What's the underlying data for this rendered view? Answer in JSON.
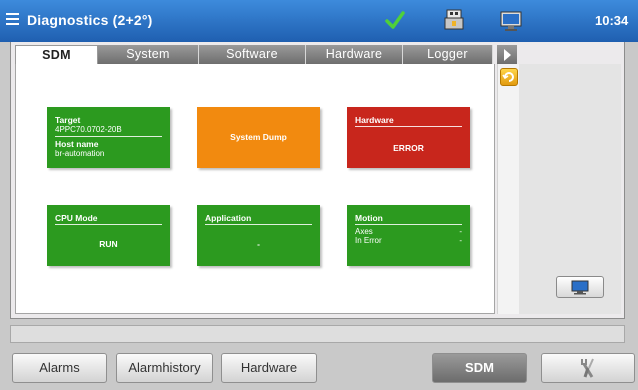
{
  "titlebar": {
    "title": "Diagnostics (2+2°)",
    "clock": "10:34",
    "icons": [
      "menu-icon",
      "check-icon",
      "usb-icon",
      "monitor-icon"
    ]
  },
  "tabs": [
    {
      "label": "SDM",
      "active": true
    },
    {
      "label": "System",
      "active": false
    },
    {
      "label": "Software",
      "active": false
    },
    {
      "label": "Hardware",
      "active": false
    },
    {
      "label": "Logger",
      "active": false
    }
  ],
  "tiles": {
    "target": {
      "title": "Target",
      "value": "4PPC70.0702-20B",
      "host_label": "Host name",
      "host_value": "br-automation",
      "color": "#2c9a1f"
    },
    "system_dump": {
      "label": "System Dump",
      "color": "#f28a0f"
    },
    "hardware": {
      "title": "Hardware",
      "status": "ERROR",
      "color": "#c8261c"
    },
    "cpu_mode": {
      "title": "CPU Mode",
      "status": "RUN",
      "color": "#2c9a1f"
    },
    "application": {
      "title": "Application",
      "status": "-",
      "color": "#2c9a1f"
    },
    "motion": {
      "title": "Motion",
      "axes_label": "Axes",
      "axes_value": "-",
      "error_label": "In Error",
      "error_value": "-",
      "color": "#2c9a1f"
    }
  },
  "bottom_buttons": {
    "alarms": "Alarms",
    "alarmhistory": "Alarmhistory",
    "hardware": "Hardware",
    "sdm": "SDM"
  }
}
